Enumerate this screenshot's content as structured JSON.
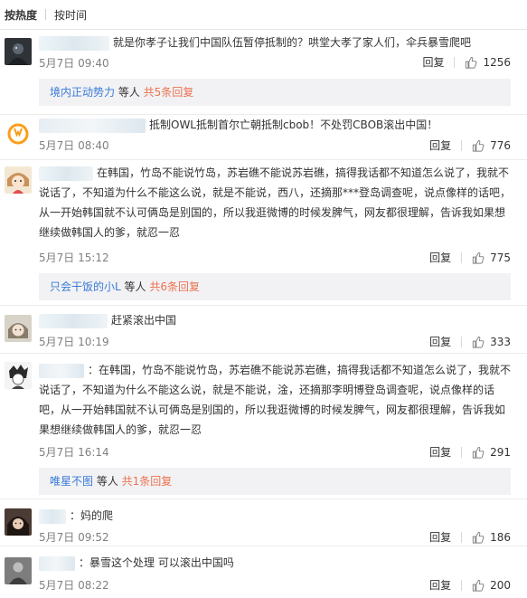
{
  "sort_tabs": {
    "hot": "按热度",
    "time": "按时间"
  },
  "colors": {
    "accent_link": "#eb7350",
    "date": "#808080",
    "subreply_bg": "#f2f2f5"
  },
  "comments": [
    {
      "avatar_icon": "dark-figure-avatar",
      "text": "就是你孝子让我们中国队伍暂停抵制的？哄堂大孝了家人们，伞兵暴雪爬吧",
      "date": "5月7日 09:40",
      "reply_label": "回复",
      "likes": "1256",
      "sub": {
        "user": "境内正动势力",
        "mid": " 等人 ",
        "count": "共5条回复"
      }
    },
    {
      "avatar_icon": "overwatch-logo-avatar",
      "text": "抵制OWL抵制首尔亡朝抵制cbob！不处罚CBOB滚出中国！",
      "date": "5月7日 08:40",
      "reply_label": "回复",
      "likes": "776"
    },
    {
      "avatar_icon": "anime-girl-avatar",
      "text": "在韩国，竹岛不能说竹岛，苏岩礁不能说苏岩礁，搞得我话都不知道怎么说了，我就不说话了，不知道为什么不能这么说，就是不能说，西八，还摘那***登岛调查呢，说点像样的话吧，从一开始韩国就不认可俩岛是别国的，所以我逛微博的时候发脾气，网友都很理解，告诉我如果想继续做韩国人的爹，就忍一忍",
      "date": "5月7日 15:12",
      "reply_label": "回复",
      "likes": "775",
      "sub": {
        "user": "只会干饭的小L",
        "mid": " 等人 ",
        "count": "共6条回复"
      }
    },
    {
      "avatar_icon": "anime-character-avatar",
      "text": "赶紧滚出中国",
      "date": "5月7日 10:19",
      "reply_label": "回复",
      "likes": "333"
    },
    {
      "avatar_icon": "sketch-character-avatar",
      "text": "：在韩国，竹岛不能说竹岛，苏岩礁不能说苏岩礁，搞得我话都不知道怎么说了，我就不说话了，不知道为什么不能这么说，就是不能说，淦，还摘那李明博登岛调查呢，说点像样的话吧，从一开始韩国就不认可俩岛是别国的，所以我逛微博的时候发脾气，网友都很理解，告诉我如果想继续做韩国人的爹，就忍一忍",
      "date": "5月7日 16:14",
      "reply_label": "回复",
      "likes": "291",
      "sub": {
        "user": "唯星不图",
        "mid": " 等人 ",
        "count": "共1条回复"
      }
    },
    {
      "avatar_icon": "dark-hair-avatar",
      "text": "：妈的爬",
      "date": "5月7日 09:52",
      "reply_label": "回复",
      "likes": "186"
    },
    {
      "avatar_icon": "grey-figure-avatar",
      "text": "：暴雪这个处理 可以滚出中国吗",
      "date": "5月7日 08:22",
      "reply_label": "回复",
      "likes": "200"
    }
  ]
}
